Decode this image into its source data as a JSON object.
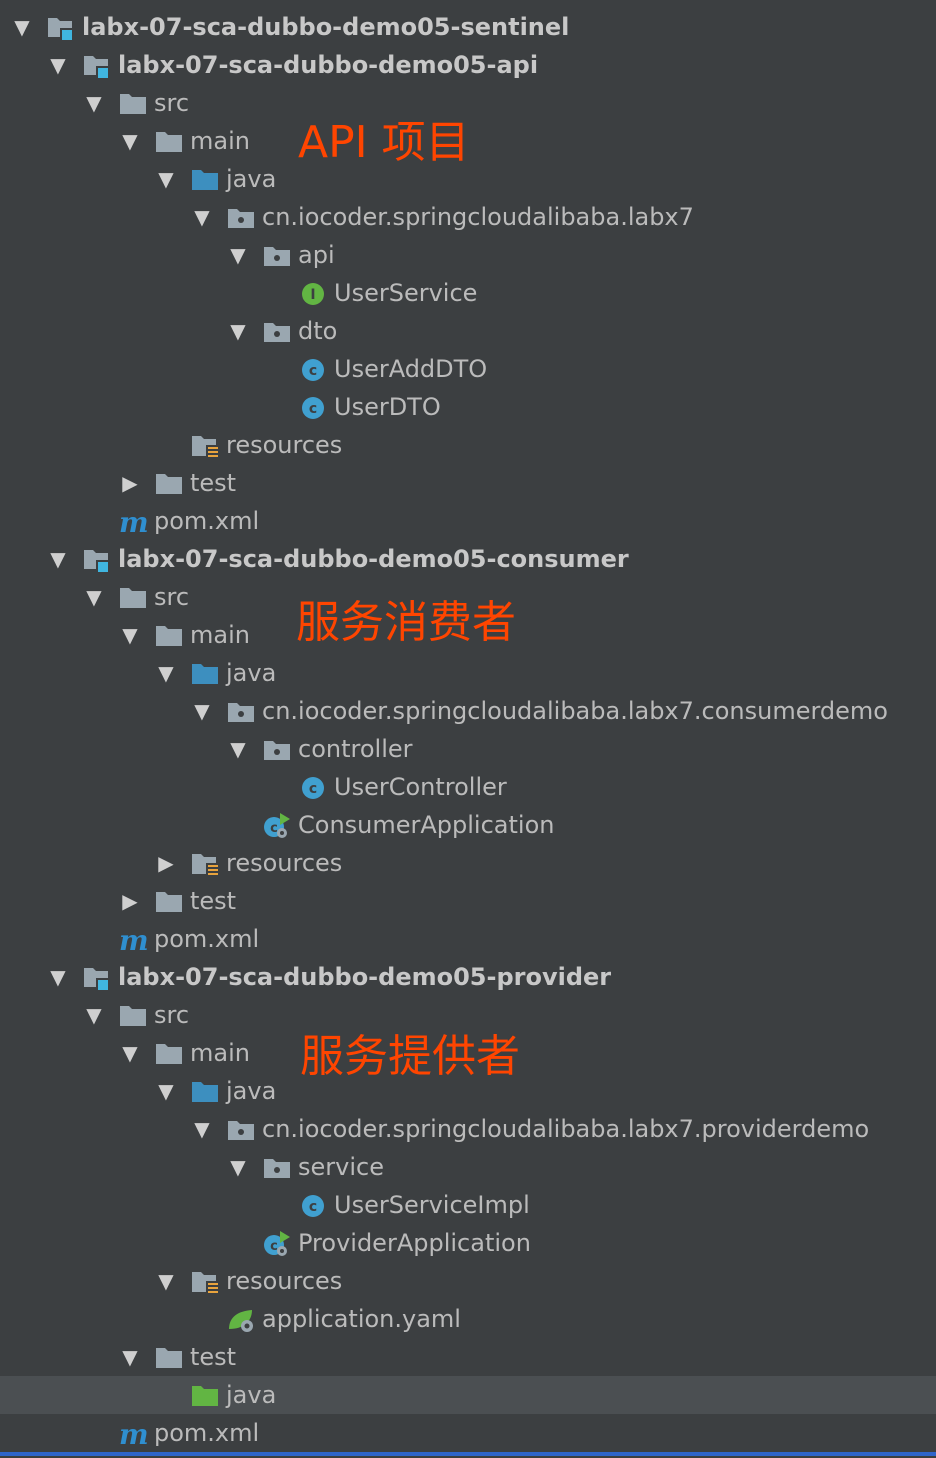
{
  "annotations": {
    "api": "API 项目",
    "consumer": "服务消费者",
    "provider": "服务提供者"
  },
  "tree": [
    {
      "level": 0,
      "arrow": "down",
      "icon": "module",
      "label": "labx-07-sca-dubbo-demo05-sentinel",
      "bold": true
    },
    {
      "level": 1,
      "arrow": "down",
      "icon": "module",
      "label": "labx-07-sca-dubbo-demo05-api",
      "bold": true
    },
    {
      "level": 2,
      "arrow": "down",
      "icon": "folder",
      "label": "src"
    },
    {
      "level": 3,
      "arrow": "down",
      "icon": "folder",
      "label": "main"
    },
    {
      "level": 4,
      "arrow": "down",
      "icon": "folder-blue",
      "label": "java"
    },
    {
      "level": 5,
      "arrow": "down",
      "icon": "package",
      "label": "cn.iocoder.springcloudalibaba.labx7"
    },
    {
      "level": 6,
      "arrow": "down",
      "icon": "package",
      "label": "api"
    },
    {
      "level": 7,
      "arrow": "none",
      "icon": "interface",
      "label": "UserService"
    },
    {
      "level": 6,
      "arrow": "down",
      "icon": "package",
      "label": "dto"
    },
    {
      "level": 7,
      "arrow": "none",
      "icon": "class",
      "label": "UserAddDTO"
    },
    {
      "level": 7,
      "arrow": "none",
      "icon": "class",
      "label": "UserDTO"
    },
    {
      "level": 4,
      "arrow": "none",
      "icon": "resources",
      "label": "resources"
    },
    {
      "level": 3,
      "arrow": "right",
      "icon": "folder",
      "label": "test"
    },
    {
      "level": 2,
      "arrow": "none",
      "icon": "maven",
      "label": "pom.xml"
    },
    {
      "level": 1,
      "arrow": "down",
      "icon": "module",
      "label": "labx-07-sca-dubbo-demo05-consumer",
      "bold": true
    },
    {
      "level": 2,
      "arrow": "down",
      "icon": "folder",
      "label": "src"
    },
    {
      "level": 3,
      "arrow": "down",
      "icon": "folder",
      "label": "main"
    },
    {
      "level": 4,
      "arrow": "down",
      "icon": "folder-blue",
      "label": "java"
    },
    {
      "level": 5,
      "arrow": "down",
      "icon": "package",
      "label": "cn.iocoder.springcloudalibaba.labx7.consumerdemo"
    },
    {
      "level": 6,
      "arrow": "down",
      "icon": "package",
      "label": "controller"
    },
    {
      "level": 7,
      "arrow": "none",
      "icon": "class",
      "label": "UserController"
    },
    {
      "level": 6,
      "arrow": "none",
      "icon": "spring-app",
      "label": "ConsumerApplication"
    },
    {
      "level": 4,
      "arrow": "right",
      "icon": "resources",
      "label": "resources"
    },
    {
      "level": 3,
      "arrow": "right",
      "icon": "folder",
      "label": "test"
    },
    {
      "level": 2,
      "arrow": "none",
      "icon": "maven",
      "label": "pom.xml"
    },
    {
      "level": 1,
      "arrow": "down",
      "icon": "module",
      "label": "labx-07-sca-dubbo-demo05-provider",
      "bold": true
    },
    {
      "level": 2,
      "arrow": "down",
      "icon": "folder",
      "label": "src"
    },
    {
      "level": 3,
      "arrow": "down",
      "icon": "folder",
      "label": "main"
    },
    {
      "level": 4,
      "arrow": "down",
      "icon": "folder-blue",
      "label": "java"
    },
    {
      "level": 5,
      "arrow": "down",
      "icon": "package",
      "label": "cn.iocoder.springcloudalibaba.labx7.providerdemo"
    },
    {
      "level": 6,
      "arrow": "down",
      "icon": "package",
      "label": "service"
    },
    {
      "level": 7,
      "arrow": "none",
      "icon": "class",
      "label": "UserServiceImpl"
    },
    {
      "level": 6,
      "arrow": "none",
      "icon": "spring-app",
      "label": "ProviderApplication"
    },
    {
      "level": 4,
      "arrow": "down",
      "icon": "resources",
      "label": "resources"
    },
    {
      "level": 5,
      "arrow": "none",
      "icon": "spring-yaml",
      "label": "application.yaml"
    },
    {
      "level": 3,
      "arrow": "down",
      "icon": "folder",
      "label": "test"
    },
    {
      "level": 4,
      "arrow": "none",
      "icon": "folder-green",
      "label": "java",
      "selected": true
    },
    {
      "level": 2,
      "arrow": "none",
      "icon": "maven",
      "label": "pom.xml"
    }
  ]
}
